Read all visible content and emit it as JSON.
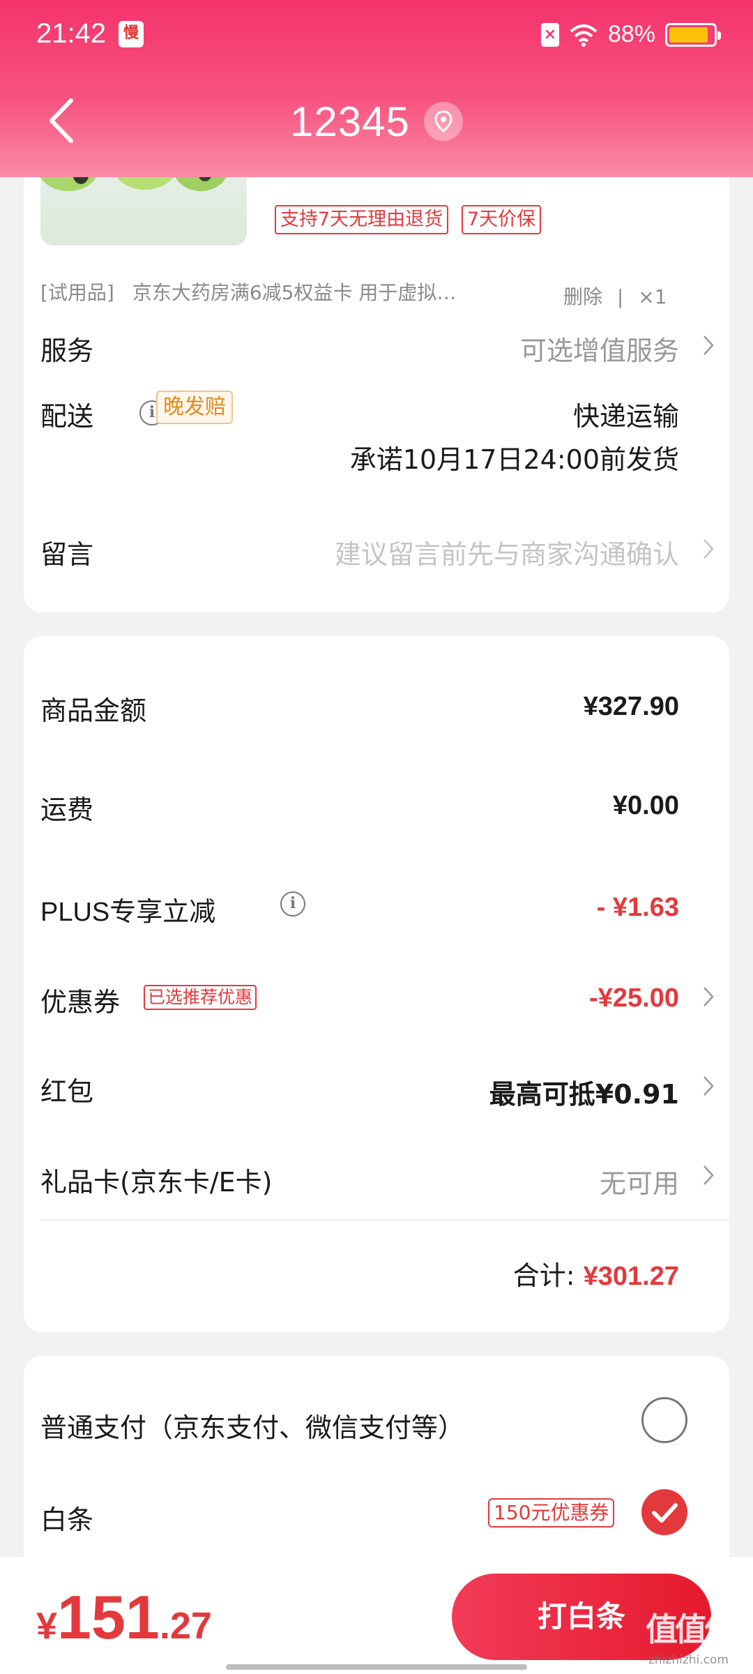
{
  "status_bar": {
    "time": "21:42",
    "app_icon_text": "慢",
    "battery": "88%",
    "battery_level": 0.88
  },
  "header": {
    "title": "12345"
  },
  "product": {
    "tags": [
      "支持7天无理由退货",
      "7天价保"
    ],
    "trial_tag": "[试用品]",
    "trial_name": "京东大药房满6减5权益卡 用于虚拟…",
    "delete_label": "删除",
    "quantity": "×1"
  },
  "service": {
    "label": "服务",
    "value": "可选增值服务"
  },
  "delivery": {
    "label": "配送",
    "badge": "晚发赔",
    "method": "快递运输",
    "promise": "承诺10月17日24:00前发货"
  },
  "message": {
    "label": "留言",
    "placeholder": "建议留言前先与商家沟通确认"
  },
  "summary": {
    "goods_label": "商品金额",
    "goods_value": "¥327.90",
    "shipping_label": "运费",
    "shipping_value": "¥0.00",
    "plus_label": "PLUS专享立减",
    "plus_value": "- ¥1.63",
    "coupon_label": "优惠券",
    "coupon_badge": "已选推荐优惠",
    "coupon_value": "-¥25.00",
    "redpack_label": "红包",
    "redpack_value": "最高可抵¥0.91",
    "giftcard_label": "礼品卡(京东卡/E卡)",
    "giftcard_value": "无可用",
    "total_label": "合计:",
    "total_value": "¥301.27"
  },
  "payment": {
    "normal_label": "普通支付（京东支付、微信支付等）",
    "baitiao_label": "白条",
    "baitiao_coupon": "150元优惠券"
  },
  "bottom": {
    "yen": "¥",
    "price_int": "151",
    "price_dec": ".27",
    "pay_button": "打白条"
  },
  "watermark": {
    "text": "值值值",
    "sub": "zhizhizhi.com"
  },
  "colors": {
    "accent_red": "#e4393c",
    "header_pink": "#f5336d",
    "battery_yellow": "#ffc107"
  }
}
